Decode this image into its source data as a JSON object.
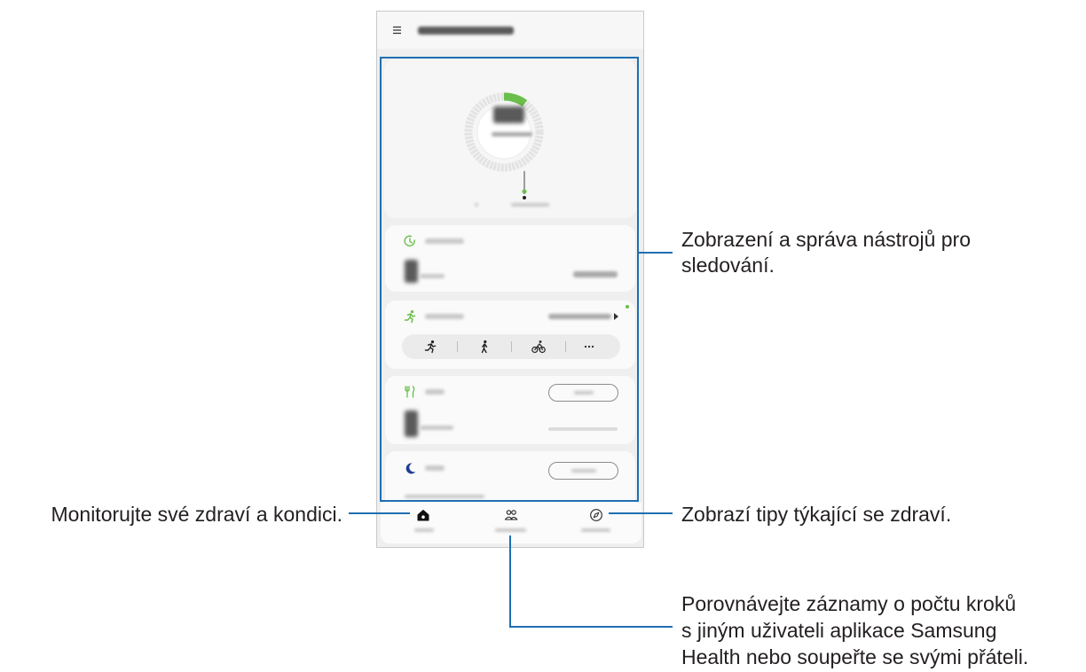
{
  "callouts": {
    "tools": {
      "line1": "Zobrazení a správa nástrojů pro",
      "line2": "sledování."
    },
    "home": "Monitorujte své zdraví a kondici.",
    "discover": "Zobrazí tipy týkající se zdraví.",
    "together": {
      "line1": "Porovnávejte záznamy o počtu kroků",
      "line2": "s jiným uživateli aplikace Samsung",
      "line3": "Health nebo soupeřte se svými přáteli."
    }
  },
  "steps": {
    "ring_fill": 0.1
  },
  "exercise_shortcuts": [
    "run-icon",
    "walk-icon",
    "cycle-icon",
    "more-icon"
  ],
  "bottom_nav": [
    "home-icon",
    "together-icon",
    "discover-icon"
  ],
  "colors": {
    "callout_blue": "#1f6fb2",
    "health_green": "#6abf4b",
    "sleep_blue": "#1c3f94",
    "text": "#231f20"
  }
}
